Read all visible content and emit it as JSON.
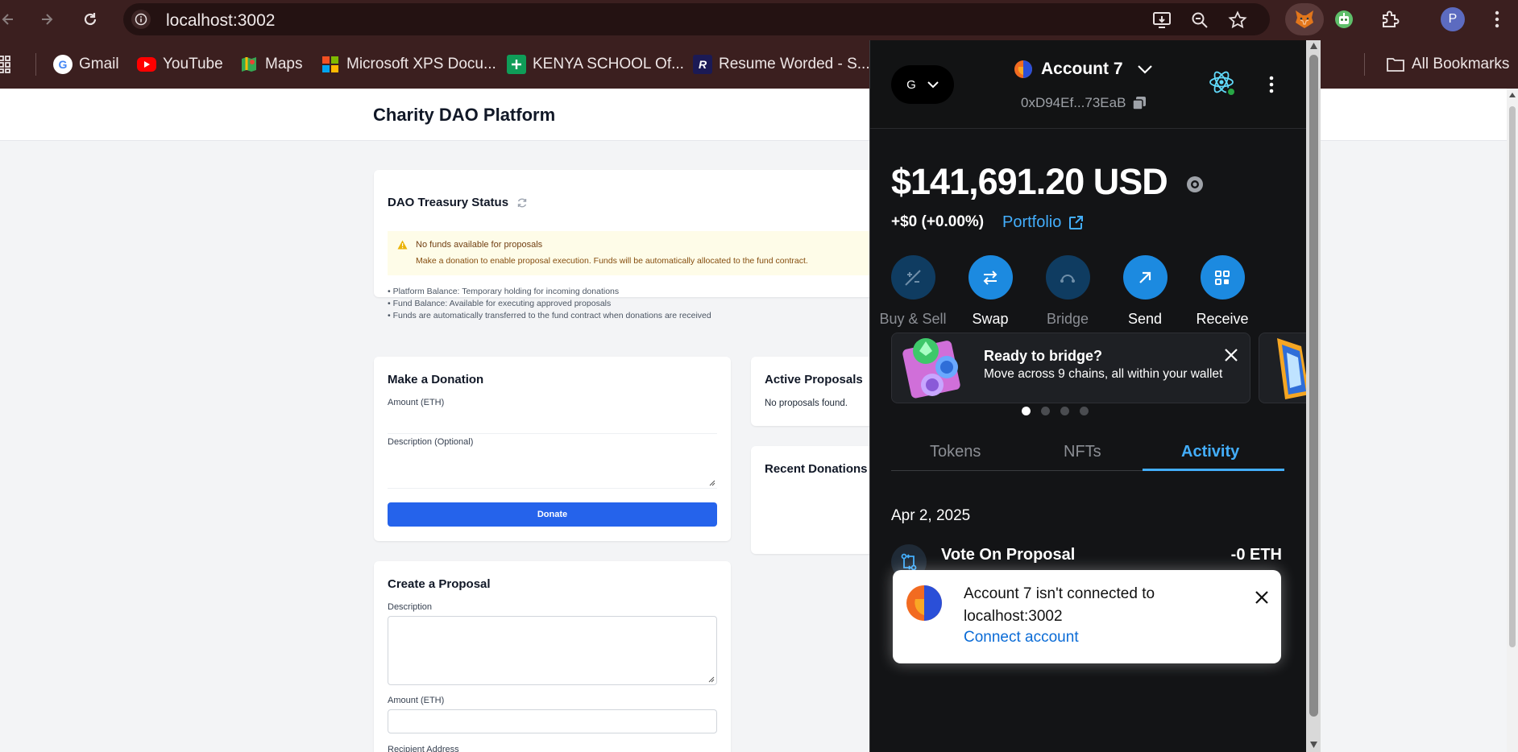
{
  "browser": {
    "url": "localhost:3002",
    "bookmarks": [
      {
        "label": "Gmail",
        "icon": "gmail-icon"
      },
      {
        "label": "YouTube",
        "icon": "youtube-icon"
      },
      {
        "label": "Maps",
        "icon": "maps-icon"
      },
      {
        "label": "Microsoft XPS Docu...",
        "icon": "microsoft-icon"
      },
      {
        "label": "KENYA SCHOOL Of...",
        "icon": "sheets-icon"
      },
      {
        "label": "Resume Worded - S...",
        "icon": "resume-worded-icon"
      }
    ],
    "all_bookmarks": "All Bookmarks",
    "profile_initial": "P"
  },
  "app": {
    "title": "Charity DAO Platform",
    "treasury": {
      "title": "DAO Treasury Status",
      "warning_title": "No funds available for proposals",
      "warning_text": "Make a donation to enable proposal execution. Funds will be automatically allocated to the fund contract.",
      "bullets": [
        "• Platform Balance: Temporary holding for incoming donations",
        "• Fund Balance: Available for executing approved proposals",
        "• Funds are automatically transferred to the fund contract when donations are received"
      ]
    },
    "donation": {
      "title": "Make a Donation",
      "amount_label": "Amount (ETH)",
      "description_label": "Description (Optional)",
      "button": "Donate"
    },
    "proposals": {
      "title": "Active Proposals",
      "empty": "No proposals found."
    },
    "recent_donations": {
      "title": "Recent Donations"
    },
    "create_proposal": {
      "title": "Create a Proposal",
      "description_label": "Description",
      "amount_label": "Amount (ETH)",
      "recipient_label": "Recipient Address"
    }
  },
  "wallet": {
    "network_initial": "G",
    "account_name": "Account 7",
    "address": "0xD94Ef...73EaB",
    "balance": "$141,691.20 USD",
    "change": "+$0 (+0.00%)",
    "portfolio_label": "Portfolio",
    "actions": [
      {
        "label": "Buy & Sell",
        "icon": "buy-sell-icon",
        "enabled": false
      },
      {
        "label": "Swap",
        "icon": "swap-icon",
        "enabled": true
      },
      {
        "label": "Bridge",
        "icon": "bridge-icon",
        "enabled": false
      },
      {
        "label": "Send",
        "icon": "send-icon",
        "enabled": true
      },
      {
        "label": "Receive",
        "icon": "receive-icon",
        "enabled": true
      }
    ],
    "promo": {
      "title": "Ready to bridge?",
      "subtitle": "Move across 9 chains, all within your wallet"
    },
    "tabs": [
      "Tokens",
      "NFTs",
      "Activity"
    ],
    "active_tab": "Activity",
    "activity": {
      "date": "Apr 2, 2025",
      "title": "Vote On Proposal",
      "amount": "-0 ETH"
    },
    "toast": {
      "message": "Account 7 isn't connected to localhost:3002",
      "link": "Connect account"
    }
  },
  "colors": {
    "chrome_bg": "#3b1f1f",
    "primary_button": "#2563eb",
    "wallet_bg": "#131416",
    "wallet_accent": "#43aefc",
    "warning_bg": "#fefce8"
  }
}
